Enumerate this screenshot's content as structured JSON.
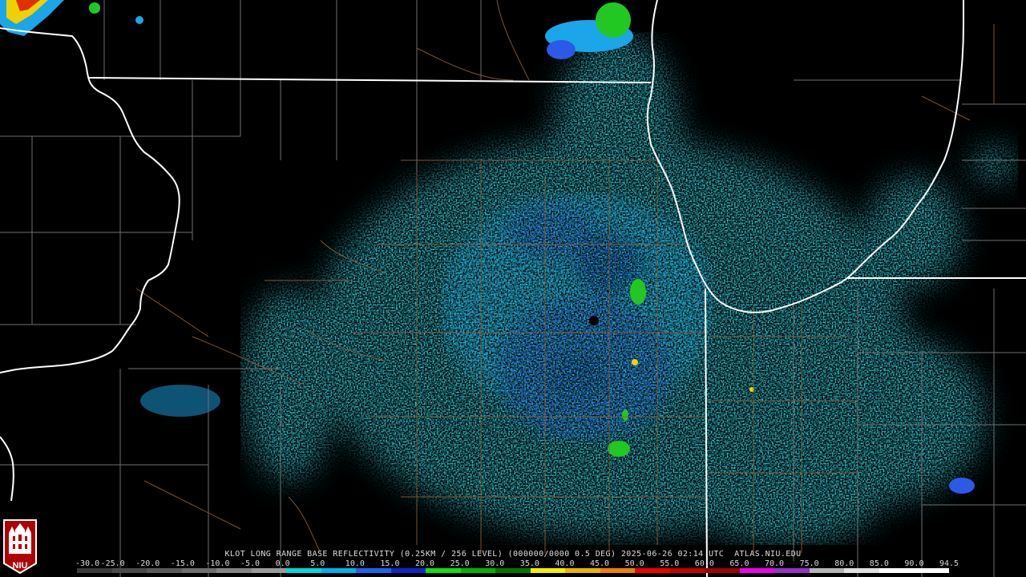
{
  "product": {
    "caption": "KLOT LONG RANGE BASE REFLECTIVITY (0.25KM / 256 LEVEL) (000000/0000 0.5 DEG) 2025-06-26 02:14 UTC  ATLAS.NIU.EDU",
    "logo_text": "NIU"
  },
  "scale": {
    "labels": [
      "-30.0",
      "-25.0",
      "-20.0",
      "-15.0",
      "-10.0",
      "-5.0",
      "0.0",
      "5.0",
      "10.0",
      "15.0",
      "20.0",
      "25.0",
      "30.0",
      "35.0",
      "40.0",
      "45.0",
      "50.0",
      "55.0",
      "60.0",
      "65.0",
      "70.0",
      "75.0",
      "80.0",
      "85.0",
      "90.0",
      "94.5"
    ],
    "colors": [
      "#3a3a3a",
      "#4a4a4a",
      "#5a5a5a",
      "#6e6e6e",
      "#848484",
      "#9a9a9a",
      "#00d8d8",
      "#00b0f0",
      "#1e64f0",
      "#0a28c8",
      "#10e010",
      "#00b400",
      "#007800",
      "#f0f000",
      "#e8b400",
      "#f08000",
      "#f00000",
      "#c80000",
      "#a00000",
      "#f000f0",
      "#9632c8",
      "#b4b4b4",
      "#e0e0e0",
      "#ffffff",
      "#ffffff"
    ],
    "colors_meaning": "reflectivity palette from -30.0 to 94.5 dBZ"
  },
  "map": {
    "radar_site": "KLOT",
    "marker_color": "#000000",
    "state_border_color": "#ffffff",
    "county_border_color": "#8b5a3c",
    "county_border_alt_color": "#707070",
    "echo_palette": {
      "light": "#29d2e0",
      "medium": "#1aa6e8",
      "dense": "#2a5ae6",
      "heavy": "#1530b8",
      "moderate": "#22c822",
      "strong": "#e8d800"
    }
  }
}
